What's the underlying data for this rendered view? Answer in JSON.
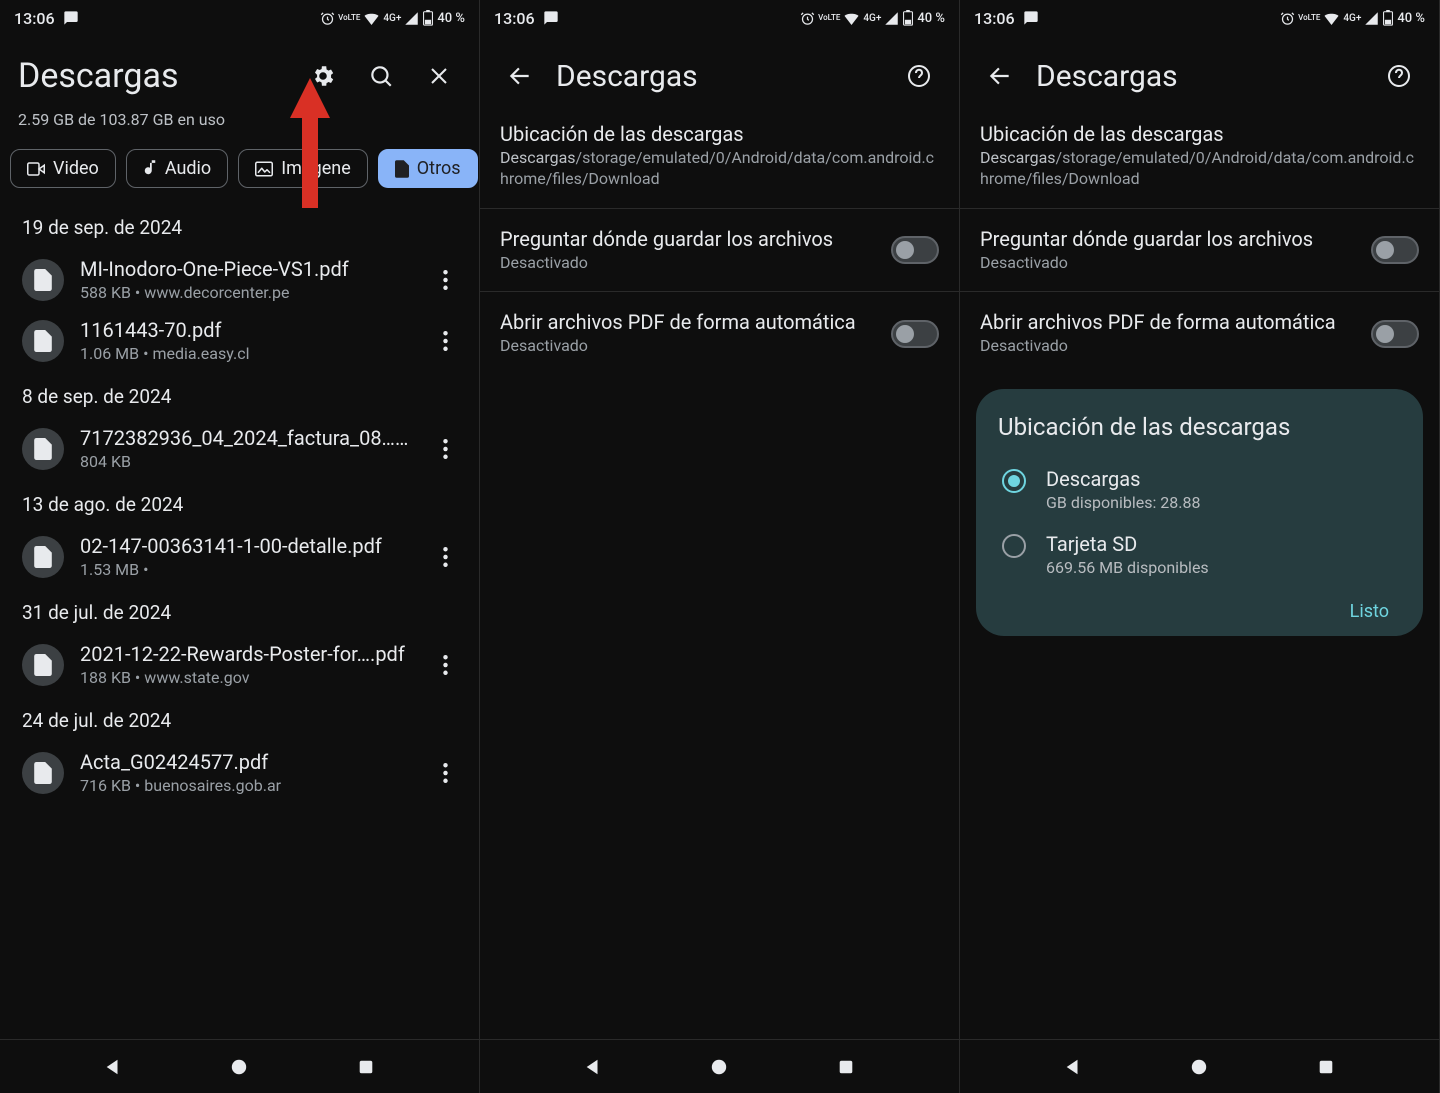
{
  "status": {
    "time": "13:06",
    "battery": "40 %",
    "net": "4G+",
    "lte": "VoLTE"
  },
  "panel1": {
    "title": "Descargas",
    "storage": "2.59 GB de 103.87 GB en uso",
    "chips": {
      "video": "Video",
      "audio": "Audio",
      "images": "Imágene",
      "otros": "Otros"
    },
    "sections": [
      {
        "date": "19 de sep. de 2024",
        "files": [
          {
            "name": "MI-Inodoro-One-Piece-VS1.pdf",
            "meta": "588 KB • www.decorcenter.pe"
          },
          {
            "name": "1161443-70.pdf",
            "meta": "1.06 MB • media.easy.cl"
          }
        ]
      },
      {
        "date": "8 de sep. de 2024",
        "files": [
          {
            "name": "7172382936_04_2024_factura_08…….",
            "meta": "804 KB"
          }
        ]
      },
      {
        "date": "13 de ago. de 2024",
        "files": [
          {
            "name": "02-147-00363141-1-00-detalle.pdf",
            "meta": "1.53 MB •"
          }
        ]
      },
      {
        "date": "31 de jul. de 2024",
        "files": [
          {
            "name": "2021-12-22-Rewards-Poster-for….pdf",
            "meta": "188 KB • www.state.gov"
          }
        ]
      },
      {
        "date": "24 de jul. de 2024",
        "files": [
          {
            "name": "Acta_G02424577.pdf",
            "meta": "716 KB • buenosaires.gob.ar"
          }
        ]
      }
    ]
  },
  "settings": {
    "title": "Descargas",
    "location": {
      "title": "Ubicación de las descargas",
      "prefix": "Descargas",
      "path": "/storage/emulated/0/Android/data/com.android.chrome/files/Download"
    },
    "ask": {
      "title": "Preguntar dónde guardar los archivos",
      "sub": "Desactivado"
    },
    "pdf": {
      "title": "Abrir archivos PDF de forma automática",
      "sub": "Desactivado"
    }
  },
  "dialog": {
    "title": "Ubicación de las descargas",
    "options": [
      {
        "label": "Descargas",
        "sub": "GB disponibles: 28.88",
        "selected": true
      },
      {
        "label": "Tarjeta SD",
        "sub": "669.56 MB disponibles",
        "selected": false
      }
    ],
    "done": "Listo"
  }
}
